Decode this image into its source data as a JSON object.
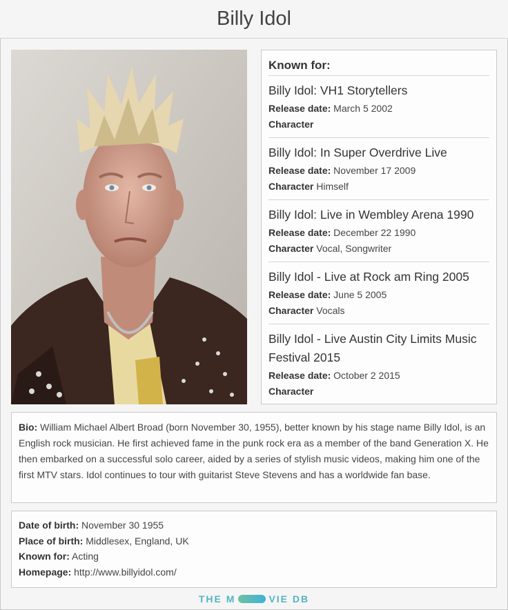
{
  "person": {
    "name": "Billy Idol"
  },
  "photo": {
    "alt": "Billy Idol portrait"
  },
  "known_for": {
    "heading": "Known for:",
    "release_label": "Release date:",
    "character_label": "Character",
    "items": [
      {
        "title": "Billy Idol: VH1 Storytellers",
        "release": "March 5 2002",
        "character": ""
      },
      {
        "title": "Billy Idol: In Super Overdrive Live",
        "release": "November 17 2009",
        "character": "Himself"
      },
      {
        "title": "Billy Idol: Live in Wembley Arena 1990",
        "release": "December 22 1990",
        "character": "Vocal, Songwriter"
      },
      {
        "title": "Billy Idol - Live at Rock am Ring 2005",
        "release": "June 5 2005",
        "character": "Vocals"
      },
      {
        "title": "Billy Idol - Live Austin City Limits Music Festival 2015",
        "release": "October 2 2015",
        "character": ""
      }
    ]
  },
  "bio": {
    "label": "Bio:",
    "text": "William Michael Albert Broad (born November 30, 1955), better known by his stage name Billy Idol, is an English rock musician. He first achieved fame in the punk rock era as a member of the band Generation X. He then embarked on a successful solo career, aided by a series of stylish music videos, making him one of the first MTV stars. Idol continues to tour with guitarist Steve Stevens and has a worldwide fan base."
  },
  "facts": {
    "dob_label": "Date of birth:",
    "dob": "November 30 1955",
    "pob_label": "Place of birth:",
    "pob": "Middlesex, England, UK",
    "known_label": "Known for:",
    "known": "Acting",
    "home_label": "Homepage:",
    "home": "http://www.billyidol.com/"
  },
  "brand": {
    "left": "THE M",
    "right": "VIE DB"
  }
}
